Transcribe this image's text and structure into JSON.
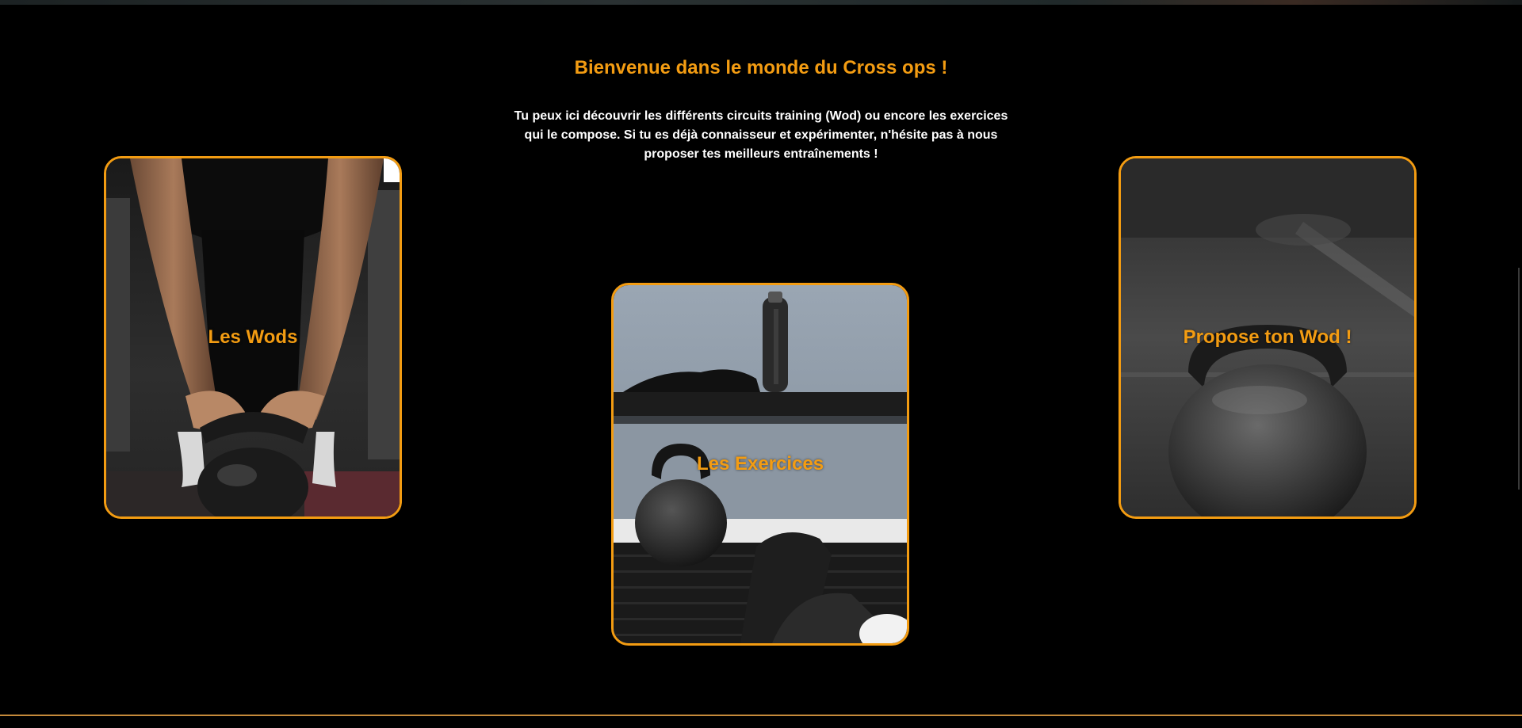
{
  "welcome": {
    "title": "Bienvenue dans le monde du Cross ops !",
    "intro": "Tu peux ici découvrir les différents circuits training (Wod) ou encore les exercices qui le compose. Si tu es déjà connaisseur et expérimenter, n'hésite pas à nous proposer tes meilleurs entraînements !"
  },
  "cards": {
    "wods": {
      "label": "Les Wods"
    },
    "exercices": {
      "label": "Les Exercices"
    },
    "propose": {
      "label": "Propose ton Wod !"
    }
  },
  "colors": {
    "accent": "#f39c12",
    "background": "#000000",
    "text": "#ffffff"
  }
}
